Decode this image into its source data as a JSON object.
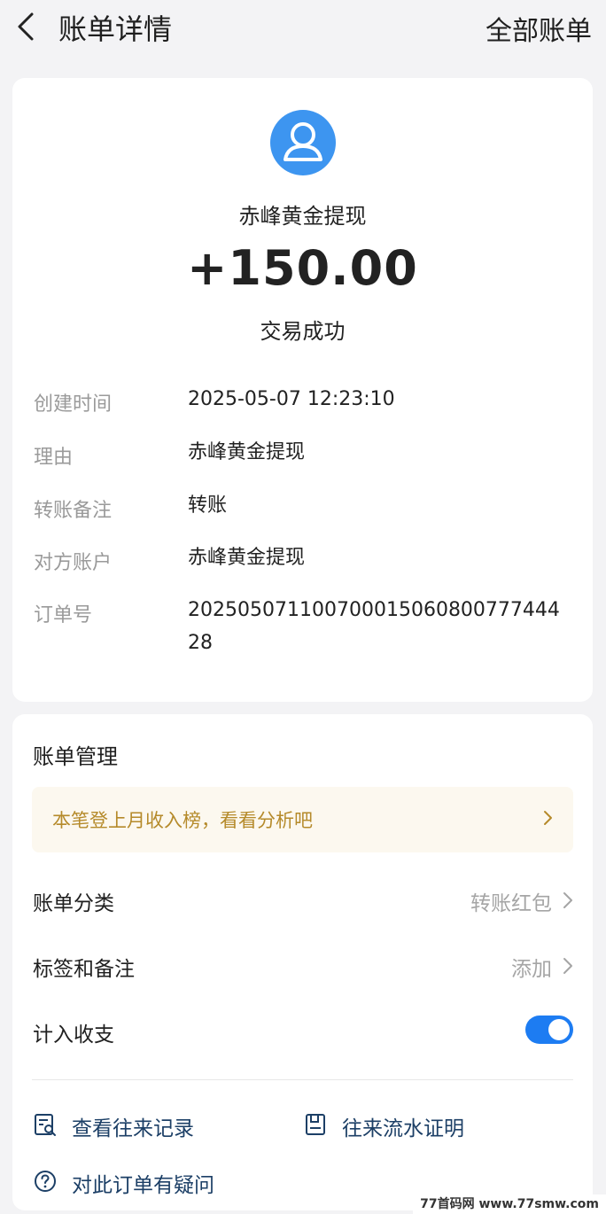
{
  "header": {
    "title": "账单详情",
    "right_action": "全部账单"
  },
  "transaction": {
    "avatar_icon": "user-avatar-icon",
    "payee": "赤峰黄金提现",
    "amount": "+150.00",
    "status": "交易成功"
  },
  "details": [
    {
      "label": "创建时间",
      "value": "2025-05-07 12:23:10"
    },
    {
      "label": "理由",
      "value": "赤峰黄金提现"
    },
    {
      "label": "转账备注",
      "value": "转账"
    },
    {
      "label": "对方账户",
      "value": "赤峰黄金提现"
    },
    {
      "label": "订单号",
      "value": "20250507110070001506080077744428"
    }
  ],
  "management": {
    "title": "账单管理",
    "promo": "本笔登上月收入榜，看看分析吧",
    "category": {
      "label": "账单分类",
      "value": "转账红包"
    },
    "tags": {
      "label": "标签和备注",
      "value": "添加"
    },
    "include": {
      "label": "计入收支",
      "enabled": true
    },
    "links": {
      "records": "查看往来记录",
      "proof": "往来流水证明",
      "question": "对此订单有疑问"
    }
  },
  "watermark": "77首码网 www.77smw.com",
  "colors": {
    "accent": "#1d7cf2",
    "avatar": "#3d95f0",
    "promo_bg": "#fcf8ef",
    "promo_text": "#b58a2a",
    "link_text": "#1c3f66"
  }
}
